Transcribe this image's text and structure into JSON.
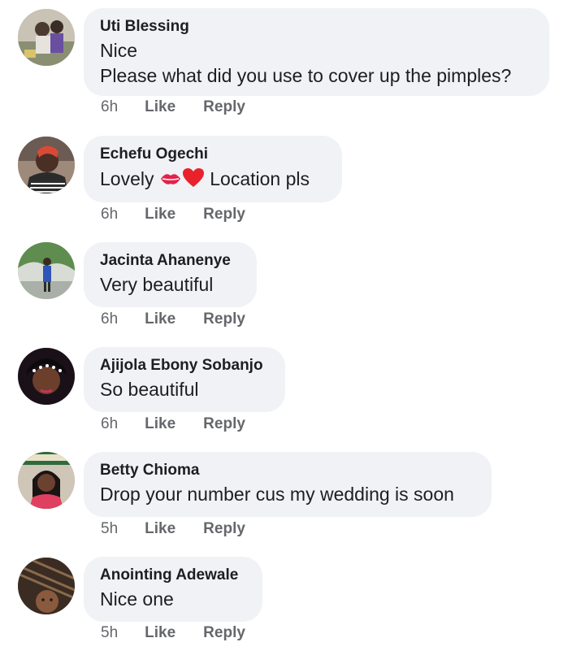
{
  "comments": [
    {
      "author": "Uti Blessing",
      "lines": [
        "Nice",
        "Please what did you use to cover up the pimples?"
      ],
      "time": "6h",
      "like_label": "Like",
      "reply_label": "Reply"
    },
    {
      "author": "Echefu Ogechi",
      "text_before": "Lovely",
      "emojis": [
        "kiss-mark-emoji",
        "red-heart-emoji"
      ],
      "text_after": "Location pls",
      "time": "6h",
      "like_label": "Like",
      "reply_label": "Reply"
    },
    {
      "author": "Jacinta Ahanenye",
      "lines": [
        "Very beautiful"
      ],
      "time": "6h",
      "like_label": "Like",
      "reply_label": "Reply"
    },
    {
      "author": "Ajijola Ebony Sobanjo",
      "lines": [
        "So beautiful"
      ],
      "time": "6h",
      "like_label": "Like",
      "reply_label": "Reply"
    },
    {
      "author": "Betty Chioma",
      "lines": [
        "Drop your number cus my wedding is soon"
      ],
      "time": "5h",
      "like_label": "Like",
      "reply_label": "Reply"
    },
    {
      "author": "Anointing Adewale",
      "lines": [
        "Nice one"
      ],
      "time": "5h",
      "like_label": "Like",
      "reply_label": "Reply"
    }
  ]
}
